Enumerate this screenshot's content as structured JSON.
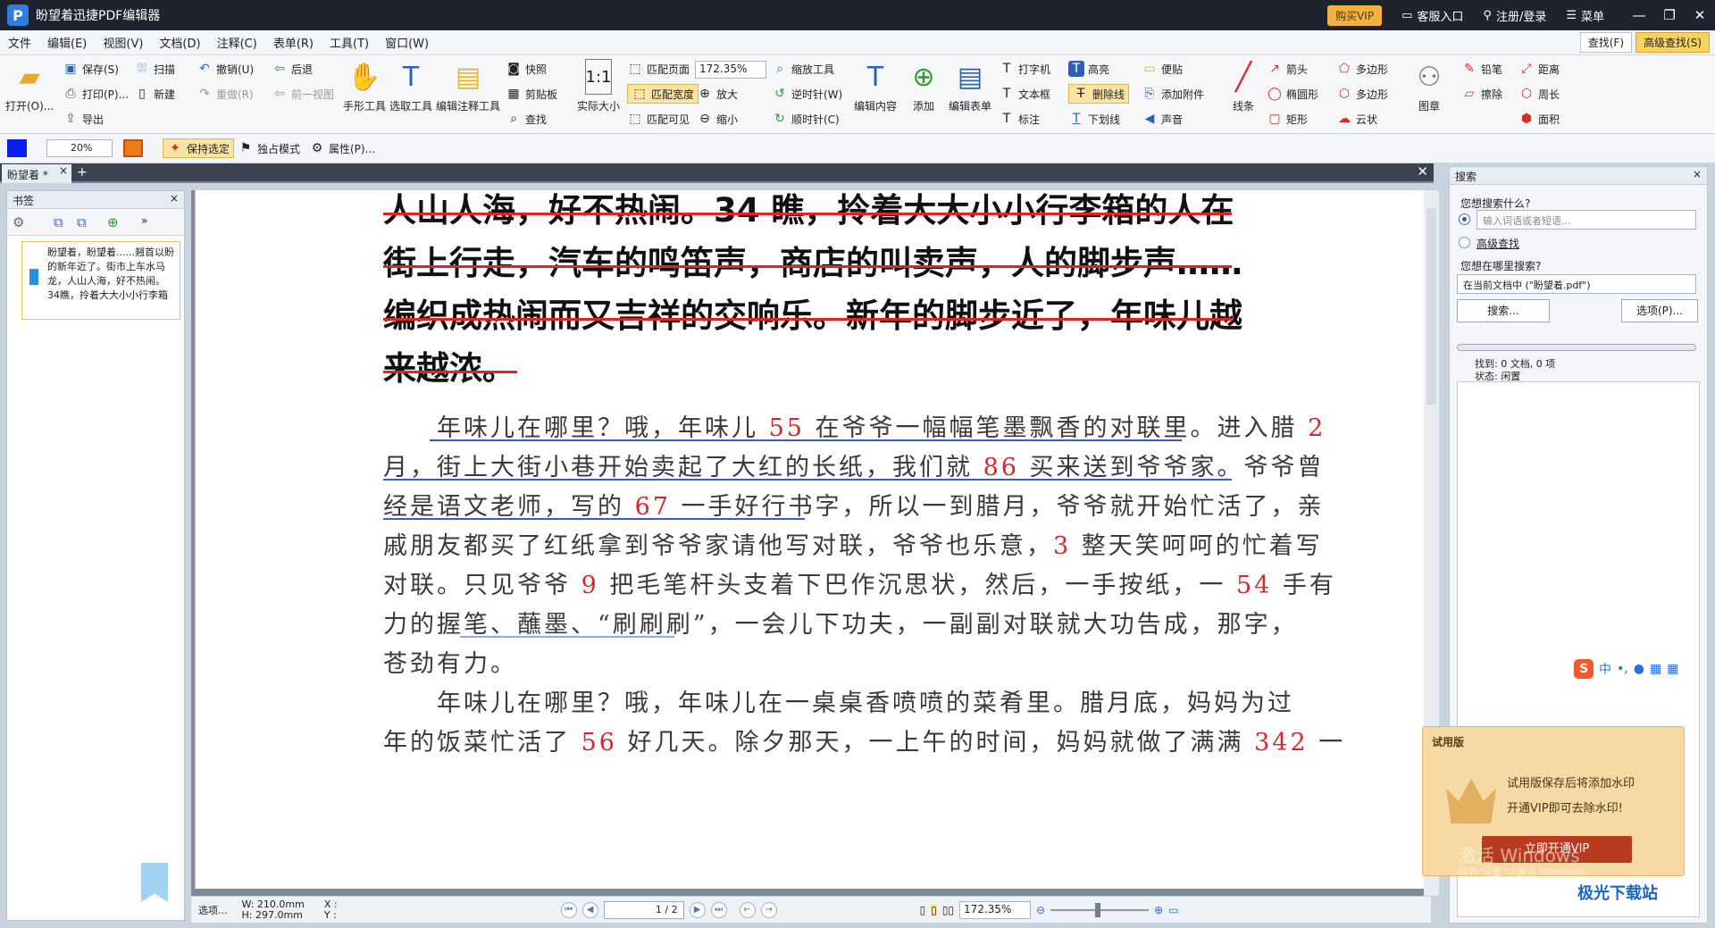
{
  "app": {
    "title": "盼望着迅捷PDF编辑器",
    "logo": "P",
    "vip_button": "购买VIP",
    "service": "客服入口",
    "login": "注册/登录",
    "menu": "菜单"
  },
  "menubar": {
    "items": [
      "文件",
      "编辑(E)",
      "视图(V)",
      "文档(D)",
      "注释(C)",
      "表单(R)",
      "工具(T)",
      "窗口(W)"
    ],
    "find": "查找(F)",
    "adv_find": "高级查找(S)"
  },
  "ribbon": {
    "open": "打开(O)...",
    "save": "保存(S)",
    "print": "打印(P)...",
    "export": "导出",
    "scan": "扫描",
    "new": "新建",
    "undo": "撤销(U)",
    "redo": "重做(R)",
    "back": "后退",
    "prev_view": "前一视图",
    "hand_tool": "手形工具",
    "select_tool": "选取工具",
    "edit_annot_tool": "编辑注释工具",
    "snapshot": "快照",
    "clipboard": "剪贴板",
    "find": "查找",
    "actual_size": "实际大小",
    "fit_page": "匹配页面",
    "fit_width": "匹配宽度",
    "fit_visible": "匹配可见",
    "zoom_value": "172.35%",
    "zoom_tool": "缩放工具",
    "zoom_in": "放大",
    "zoom_out": "缩小",
    "rotate_ccw": "逆时针(W)",
    "rotate_cw": "顺时针(C)",
    "edit_content": "编辑内容",
    "add": "添加",
    "edit_form": "编辑表单",
    "typewriter": "打字机",
    "textbox": "文本框",
    "callout": "标注",
    "highlight": "高亮",
    "strikethrough": "删除线",
    "underline": "下划线",
    "note": "便贴",
    "attach": "添加附件",
    "sound": "声音",
    "line": "线条",
    "arrow": "箭头",
    "ellipse": "椭圆形",
    "rectangle": "矩形",
    "polygon": "多边形",
    "polyline": "多边形",
    "cloud": "云状",
    "stamp": "图章",
    "pencil": "铅笔",
    "eraser": "擦除",
    "distance": "距离",
    "perimeter": "周长",
    "area": "面积"
  },
  "propbar": {
    "opacity": "20%",
    "keep_selected": "保持选定",
    "exclusive": "独占模式",
    "properties": "属性(P)..."
  },
  "tabs": [
    {
      "label": "盼望着 *"
    }
  ],
  "bookmarks": {
    "title": "书签",
    "item_text": "盼望着，盼望着......翘首以盼的新年近了。街市上车水马龙，人山人海，好不热闹。34瞧，拎着大大小小行李箱"
  },
  "document": {
    "heading_lines": [
      "人山人海，好不热闹。34 瞧，拎着大大小小行李箱的人在",
      "街上行走，汽车的鸣笛声，商店的叫卖声，人的脚步声……",
      "编织成热闹而又吉祥的交响乐。新年的脚步近了，年味儿越",
      "来越浓。"
    ],
    "p1": [
      [
        "　　年味儿在哪里？哦，年味儿 ",
        "55",
        " 在爷爷一幅幅笔墨飘香的对联里。进入腊 ",
        "2",
        ""
      ],
      [
        "月，街上大街小巷开始卖起了大红的长纸，我们就 ",
        "86",
        " 买来送到爷爷家。爷爷曾",
        "",
        ""
      ],
      [
        "经是语文老师，写的 ",
        "67",
        " 一手好行书字，所以一到腊月，爷爷就开始忙活了，亲",
        "",
        ""
      ],
      [
        "戚朋友都买了红纸拿到爷爷家请他写对联，爷爷也乐意，",
        "3",
        " 整天笑呵呵的忙着写",
        "",
        ""
      ],
      [
        "对联。只见爷爷 ",
        "9",
        " 把毛笔杆头支着下巴作沉思状，然后，一手按纸，一 ",
        "54",
        " 手有"
      ],
      [
        "力的握笔、蘸墨、“刷刷刷”，一会儿下功夫，一副副对联就大功告成，那字，",
        "",
        "",
        "",
        ""
      ],
      [
        "苍劲有力。",
        "",
        "",
        "",
        ""
      ]
    ],
    "p2": [
      [
        "　　年味儿在哪里？哦，年味儿在一桌桌香喷喷的菜肴里。腊月底，妈妈为过",
        "",
        "",
        "",
        ""
      ],
      [
        "年的饭菜忙活了 ",
        "56",
        " 好几天。除夕那天，一上午的时间，妈妈就做了满满 ",
        "342",
        " 一"
      ]
    ]
  },
  "statusbar": {
    "options": "选项...",
    "width": "W: 210.0mm",
    "height": "H: 297.0mm",
    "x": "X :",
    "y": "Y :",
    "page": "1 / 2",
    "zoom": "172.35%"
  },
  "search": {
    "title": "搜索",
    "what_label": "您想搜索什么?",
    "placeholder": "输入词语或者短语...",
    "advanced": "高级查找",
    "where_label": "您想在哪里搜索?",
    "where_value": "在当前文档中 (\"盼望着.pdf\")",
    "search_btn": "搜索...",
    "options_btn": "选项(P)...",
    "found": "找到: 0 文档, 0 项",
    "status": "状态: 闲置"
  },
  "trial": {
    "title": "试用版",
    "line1": "试用版保存后将添加水印",
    "line2": "开通VIP即可去除水印!",
    "button": "立即开通VIP",
    "watermark1": "激活 Windows",
    "watermark2": "转到\"设置\"以激活 Windows。"
  },
  "ime": {
    "s": "S",
    "lang": "中"
  },
  "site": "极光下载站",
  "colors": {
    "accent": "#2f7de1",
    "strike_red": "#e02424",
    "strike_blue": "#3e58c9",
    "number_red": "#d9262c"
  }
}
